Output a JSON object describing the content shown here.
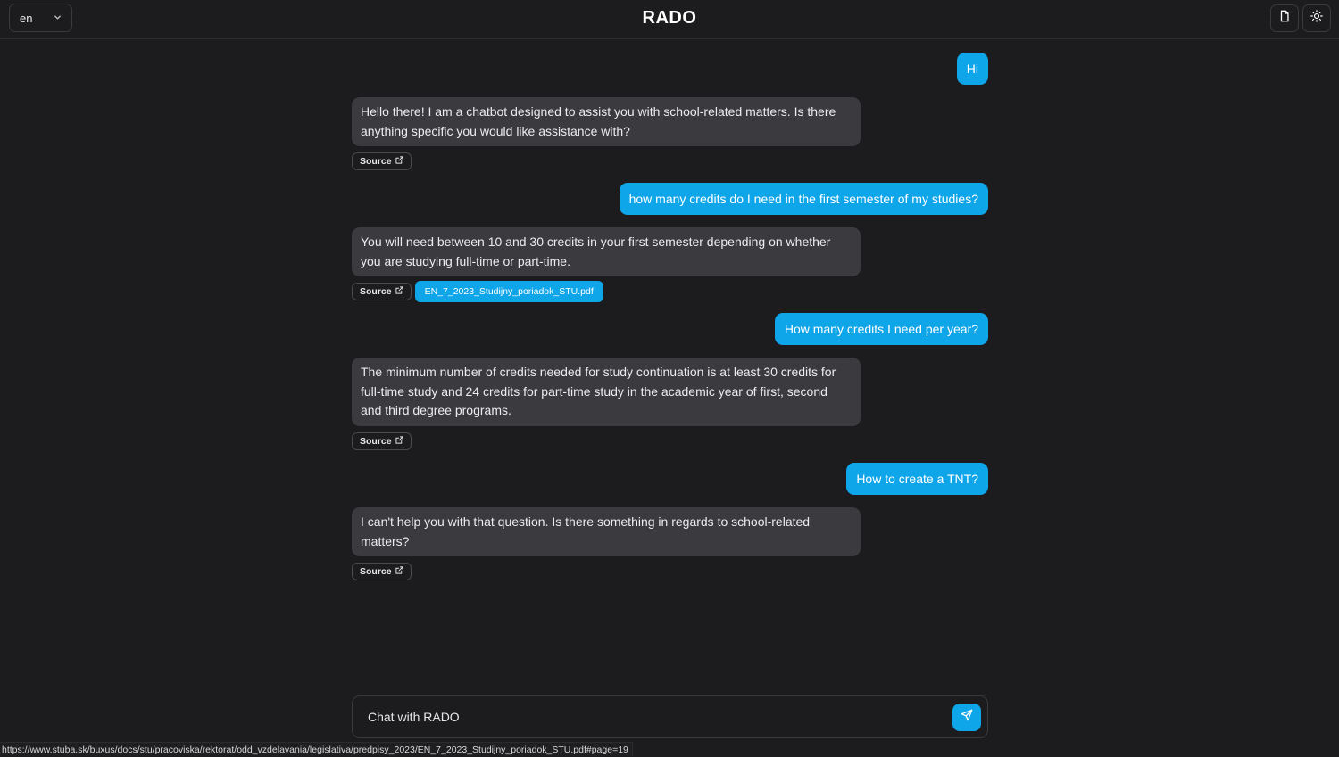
{
  "header": {
    "language": "en",
    "title": "RADO"
  },
  "messages": [
    {
      "role": "user",
      "text": "Hi"
    },
    {
      "role": "bot",
      "text": "Hello there! I am a chatbot designed to assist you with school-related matters. Is there anything specific you would like assistance with?",
      "source_label": "Source"
    },
    {
      "role": "user",
      "text": "how many credits do I need in the first semester of my studies?"
    },
    {
      "role": "bot",
      "text": "You will need between 10 and 30 credits in your first semester depending on whether you are studying full-time or part-time.",
      "source_label": "Source",
      "file": "EN_7_2023_Studijny_poriadok_STU.pdf"
    },
    {
      "role": "user",
      "text": "How many credits I need per year?"
    },
    {
      "role": "bot",
      "text": "The minimum number of credits needed for study continuation is at least 30 credits for full-time study and 24 credits for part-time study in the academic year of first, second and third degree programs.",
      "source_label": "Source"
    },
    {
      "role": "user",
      "text": "How to create a TNT?"
    },
    {
      "role": "bot",
      "text": "I can't help you with that question. Is there something in regards to school-related matters?",
      "source_label": "Source"
    }
  ],
  "input": {
    "placeholder": "Chat with RADO"
  },
  "status_bar": {
    "url": "https://www.stuba.sk/buxus/docs/stu/pracoviska/rektorat/odd_vzdelavania/legislativa/predpisy_2023/EN_7_2023_Studijny_poriadok_STU.pdf#page=19"
  },
  "icons": {
    "language_chevron": "chevron-down-icon",
    "documents": "file-icon",
    "theme": "sun-icon",
    "source_link": "external-link-icon",
    "send": "send-icon"
  },
  "colors": {
    "accent": "#0ea5e9",
    "background": "#1c1c1e",
    "bot_bubble": "#3a3a3f"
  }
}
